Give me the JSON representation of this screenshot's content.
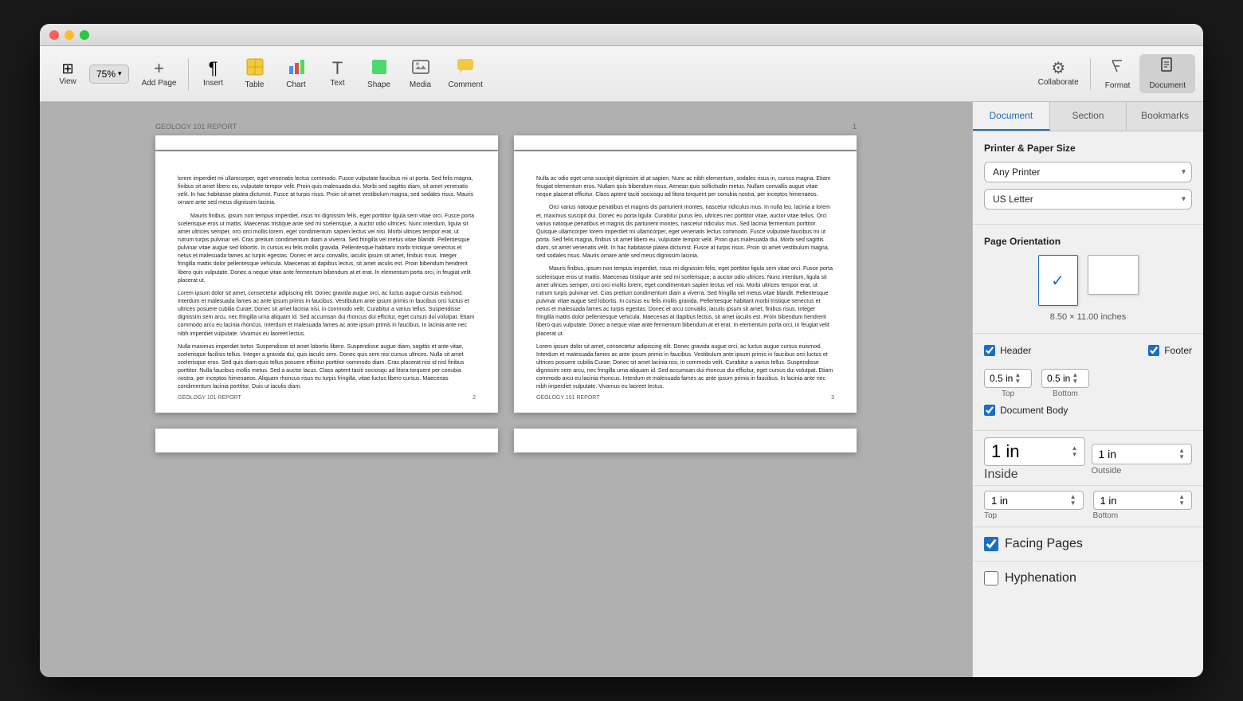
{
  "window": {
    "title": "Geology 101 Report"
  },
  "toolbar": {
    "view_label": "View",
    "zoom_label": "75%",
    "add_page_label": "Add Page",
    "insert_label": "Insert",
    "table_label": "Table",
    "chart_label": "Chart",
    "text_label": "Text",
    "shape_label": "Shape",
    "media_label": "Media",
    "comment_label": "Comment",
    "collaborate_label": "Collaborate",
    "format_label": "Format",
    "document_label": "Document"
  },
  "panel": {
    "tab_document": "Document",
    "tab_section": "Section",
    "tab_bookmarks": "Bookmarks",
    "printer_paper_size_title": "Printer & Paper Size",
    "any_printer": "Any Printer",
    "us_letter": "US Letter",
    "page_orientation_title": "Page Orientation",
    "page_size_label": "8.50 × 11.00 inches",
    "header_label": "Header",
    "footer_label": "Footer",
    "header_value": "0.5 in",
    "footer_value": "0.5 in",
    "header_top_label": "Top",
    "footer_bottom_label": "Bottom",
    "document_body_label": "Document Body",
    "inside_value": "1 in",
    "inside_label": "Inside",
    "outside_value": "1 in",
    "outside_label": "Outside",
    "top_margin_value": "1 in",
    "bottom_margin_value": "1 in",
    "facing_pages_label": "Facing Pages",
    "hyphenation_label": "Hyphenation"
  },
  "document": {
    "header_text": "GEOLOGY 101 REPORT",
    "page2_footer": "GEOLOGY 101 REPORT",
    "page2_num": "2",
    "page3_footer": "GEOLOGY 101 REPORT",
    "page3_num": "3",
    "page2_body": "lorem imperdiet mi ullamcorper, eget venenatis lectus commodo. Fusce vulputate faucibus mi ut porta. Sed felis magna, finibus sit amet libero eu, vulputate tempor velit. Proin quis malesuada dui. Morbi sed sagittis diam, sit amet venenatis velit. In hac habitasse platea dictumst. Fusce at turpis risus. Proin sit amet vestibulum magna, sed sodales risus. Mauris ornare ante sed meus dignissim lacinia.\n\nMauris finibus, ipsum non tempus imperdiet, risus mi dignissim felis, eget porttitor ligula sem vitae orci. Fusce porta scelerisque eros ut mattis. Maecenas tristique ante sed mi scelerisque, a auctor odio ultrices. Nunc interdum, ligula sit amet ultrices semper, orci orci mollis lorem, eget condimentum sapien lectus vel nisi. Morbi ultrices tempor erat, ut rutrum turpis pulvinar vel. Cras pretium condimentum diam a viverra. Sed fringilla vel metus vitae blandit. Pellentesque pulvinar vitae augue sed lobortis. In cursus eu felis mollis gravida. Pellentesque habitant morbi tristique senectus et netus et malesuada fames ac turpis egestas. Donec et arcu convallis, iaculis ipsum sit amet, finibus risus. Integer fringilla mattis dolor pellentesque vehicula. Maecenas at dapibus lectus, sit amet iaculis est. Proin bibendum hendrerit libero quis vulputate. Donec a neque vitae ante fermentum bibendum at et erat. In elementum porta orci, in feugiat velit placerat ut.\n\nLorem ipsum dolor sit amet, consectetur adipiscing elit. Donec gravida augue orci, ac luctus augue cursus euismod. Interdum et malesuada fames ac ante ipsum primis in faucibus. Vestibulum ante ipsum primis in faucibus orci luctus et ultrices posuere cubilia Curae; Donec sit amet lacinia nisi, in commodo velit. Curabitur a varius tellus. Suspendisse dignissim sem arcu, nec fringilla urna aliquam id. Sed accumsan dui rhoncus dui efficitur, eget cursus dui volutpat. Etiam commodo arcu eu lacinia rhoncus. Interdum et malesuada fames ac ante ipsum primis in faucibus. In lacinia ante nec nibh imperdiet vulputate. Vivamus eu laoreet lectus.\n\nNulla maximus imperdiet tortor. Suspendisse sit amet lobortis libero. Suspendisse augue diam, sagittis et ante vitae, scelerisque facilisis tellus. Integer a gravida dui, quis iaculis sem. Donec quis sem nisi cursus ultrices. Nulla sit amet scelerisque eros. Sed quis diam quis tellus posuere efficitur porttitor commodo diam. Cras placerat nisi id nisl finibus porttitor. Nulla faucibus mollis metus. Sed a auctor lacus. Class aptent taciti sociosqu ad litora torquent per conubia nostra, per inceptos himenaeos. Aliquam rhoncus risus eu turpis fringilla, vitae luctus libero cursus. Maecenas condimentum lacinia porttitor. Duis ut iaculis diam.",
    "page3_body": "Nulla ac odio eget urna suscipit dignissim id at sapien. Nunc ac nibh elementum, sodales risus in, cursus magna. Etiam feugiat elementum eros. Nullam quis bibendum risus. Aenean quis sollicitudin metus. Nullam convallis augue vitae neque placerat efficitur. Class aptent taciti sociosqu ad litora torquent per conubia nostra, per inceptos himenaeos.\n\nOrci varius natoque penatibus et magnis dis parturient montes, nascetur ridiculus mus. In nulla leo, lacinia a lorem et, maximus suscipit dui. Donec eu porta ligula. Curabitur purus leo, ultrices nec porttitor vitae, auctor vitae tellus. Orci varius natoque penatibus et magnis dis parturient montes, nascetur ridiculus mus. Sed lacinia fermentum porttitor. Quisque ullamcorper lorem imperdiet mi ullamcorper, eget venenatis lectus commodo. Fusce vulputate faucibus mi ut porta. Sed felis magna, finibus sit amet libero eu, vulputate tempor velit. Proin quis malesuada dui. Morbi sed sagittis diam, sit amet venenatis velit. In hac habitasse platea dictumst. Fusce at turpis risus. Proin sit amet vestibulum magna, sed sodales risus. Mauris ornare ante sed meus dignissim lacinia.\n\nMauris finibus, ipsum non tempus imperdiet, risus mi dignissim felis, eget porttitor ligula sem vitae orci. Fusce porta scelerisque eros ut mattis. Maecenas tristique ante sed mi scelerisque, a auctor odio ultrices. Nunc interdum, ligula sit amet ultrices semper, orci orci mollis lorem, eget condimentum sapien lectus vel nisi. Morbi ultrices tempor erat, ut rutrum turpis pulvinar vel. Cras pretium condimentum diam a viverra. Sed fringilla vel metus vitae blandit. Pellentesque pulvinar vitae augue sed lobortis. In cursus eu felis mollis gravida. Pellentesque habitant morbi tristique senectus et netus et malesuada fames ac turpis egestas. Donec et arcu convallis, iaculis ipsum sit amet, finibus risus. Integer fringilla mattis dolor pellentesque vehicula. Maecenas at dapibus lectus, sit amet iaculis est. Proin bibendum hendrerit libero quis vulputate. Donec a neque vitae ante fermentum bibendum at et erat. In elementum porta orci, in feugiat velit placerat ut.\n\nLorem ipsum dolor sit amet, consectetur adipiscing elit. Donec gravida augue orci, ac luctus augue cursus euismod. Interdum et malesuada fames ac ante ipsum primis in faucibus. Vestibulum ante ipsum primis in faucibus orci luctus et ultrices posuere cubilia Curae; Donec sit amet lacinia nisi, in commodo velit. Curabitur a varius tellus. Suspendisse dignissim sem arcu, nec fringilla urna aliquam id. Sed accumsan dui rhoncus dui efficitur, eget cursus dui volutpat. Etiam commodo arcu eu lacinia rhoncus. Interdum et malesuada fames ac ante ipsum primis in faucibus. In lacinia ante nec nibh imperdiet vulputate. Vivamus eu laoreet lectus."
  },
  "icons": {
    "view": "⊞",
    "zoom_arrow": "▾",
    "add_page": "+",
    "insert": "¶",
    "table": "⊞",
    "chart": "📊",
    "text": "T",
    "shape": "⬛",
    "media": "🖼",
    "comment": "💬",
    "collaborate": "⚙",
    "format": "🖊",
    "document": "📄",
    "chevron_down": "▾",
    "check": "✓",
    "checkbox_checked": "☑",
    "checkbox_unchecked": "☐"
  }
}
